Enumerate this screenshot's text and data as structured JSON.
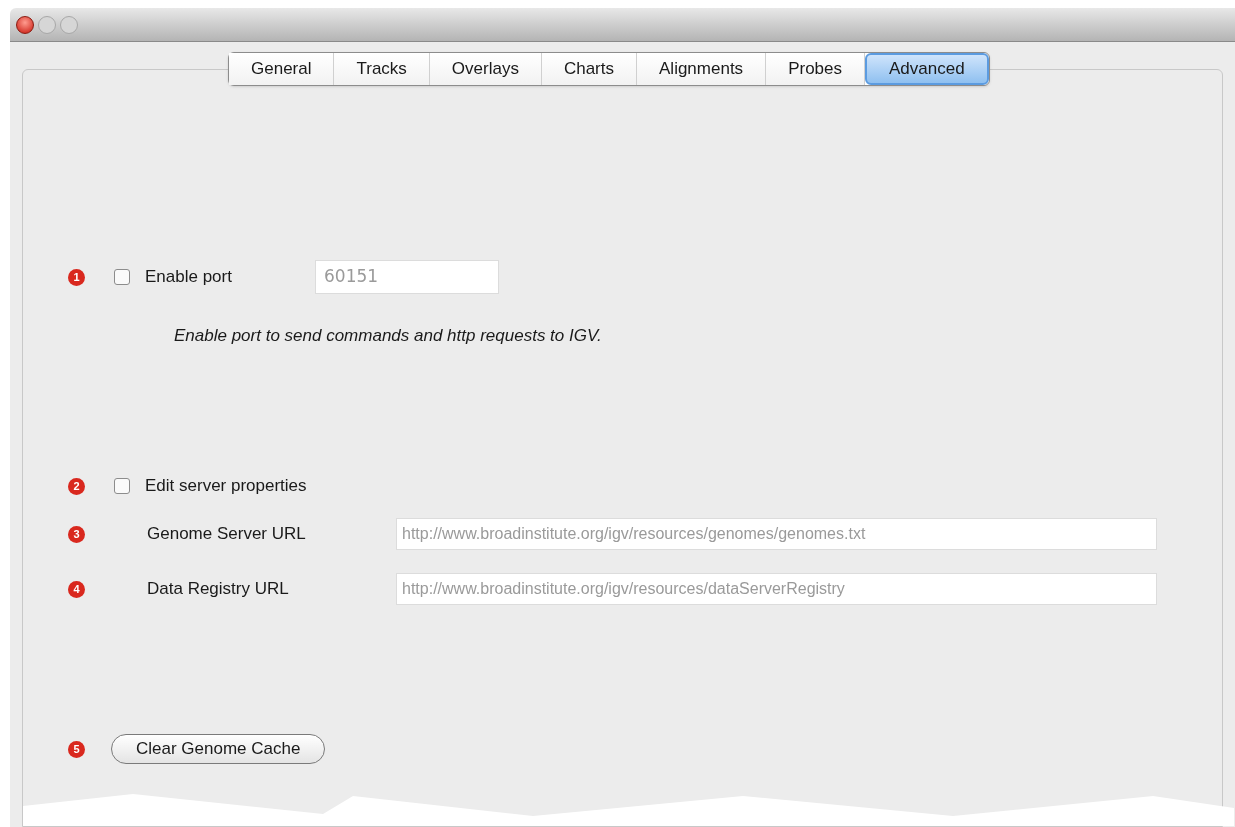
{
  "tabs": [
    {
      "label": "General",
      "selected": false
    },
    {
      "label": "Tracks",
      "selected": false
    },
    {
      "label": "Overlays",
      "selected": false
    },
    {
      "label": "Charts",
      "selected": false
    },
    {
      "label": "Alignments",
      "selected": false
    },
    {
      "label": "Probes",
      "selected": false
    },
    {
      "label": "Advanced",
      "selected": true
    }
  ],
  "rows": [
    {
      "kind": "checkbox-field",
      "badge": "1",
      "label": "Enable port",
      "checked": false,
      "value": "60151"
    },
    {
      "kind": "note",
      "text": "Enable port to send commands and http requests to IGV."
    },
    {
      "kind": "checkbox",
      "badge": "2",
      "label": "Edit server properties",
      "checked": false
    },
    {
      "kind": "url-field",
      "badge": "3",
      "label": "Genome Server URL",
      "value": "http://www.broadinstitute.org/igv/resources/genomes/genomes.txt"
    },
    {
      "kind": "url-field",
      "badge": "4",
      "label": "Data Registry URL",
      "value": "http://www.broadinstitute.org/igv/resources/dataServerRegistry"
    },
    {
      "kind": "button",
      "badge": "5",
      "label": "Clear Genome Cache"
    }
  ]
}
